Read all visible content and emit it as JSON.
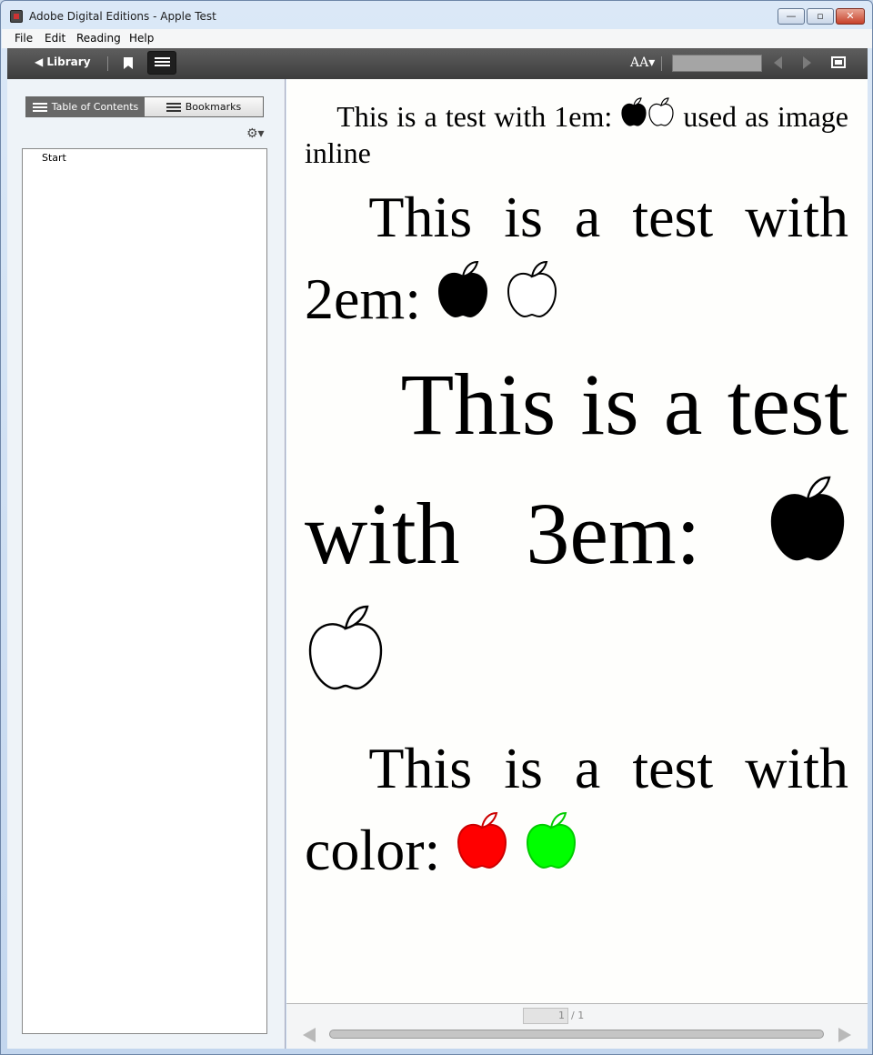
{
  "window": {
    "title": "Adobe Digital Editions - Apple Test",
    "minimize": "—",
    "maximize": "▫",
    "close": "✕"
  },
  "menu": [
    "File",
    "Edit",
    "Reading",
    "Help"
  ],
  "toolbar": {
    "library_label": "◀ Library",
    "font_size_label": "AA▾",
    "page_field_value": ""
  },
  "sidebar": {
    "tabs": [
      {
        "label": "Table of Contents",
        "active": true
      },
      {
        "label": "Bookmarks",
        "active": false
      }
    ],
    "toc_items": [
      "Start"
    ]
  },
  "content": {
    "paragraphs": [
      {
        "before": "This is a test with 1em: ",
        "after": " used as image inline",
        "apple_fill": [
          "#000000",
          "#ffffff"
        ]
      },
      {
        "before": "This is a test with 2em: ",
        "after": "",
        "apple_fill": [
          "#000000",
          "#ffffff"
        ]
      },
      {
        "before": "This is a test with 3em: ",
        "after": "",
        "apple_fill": [
          "#000000",
          "#ffffff"
        ]
      },
      {
        "before": "This is a test with color: ",
        "after": "",
        "apple_fill": [
          "#ff0000",
          "#00ff00"
        ]
      }
    ]
  },
  "pager": {
    "current": "1",
    "total": "/ 1"
  },
  "colors": {
    "toolbar": "#4a4a4a",
    "apple_red": "#ff0000",
    "apple_green": "#00ff00"
  }
}
